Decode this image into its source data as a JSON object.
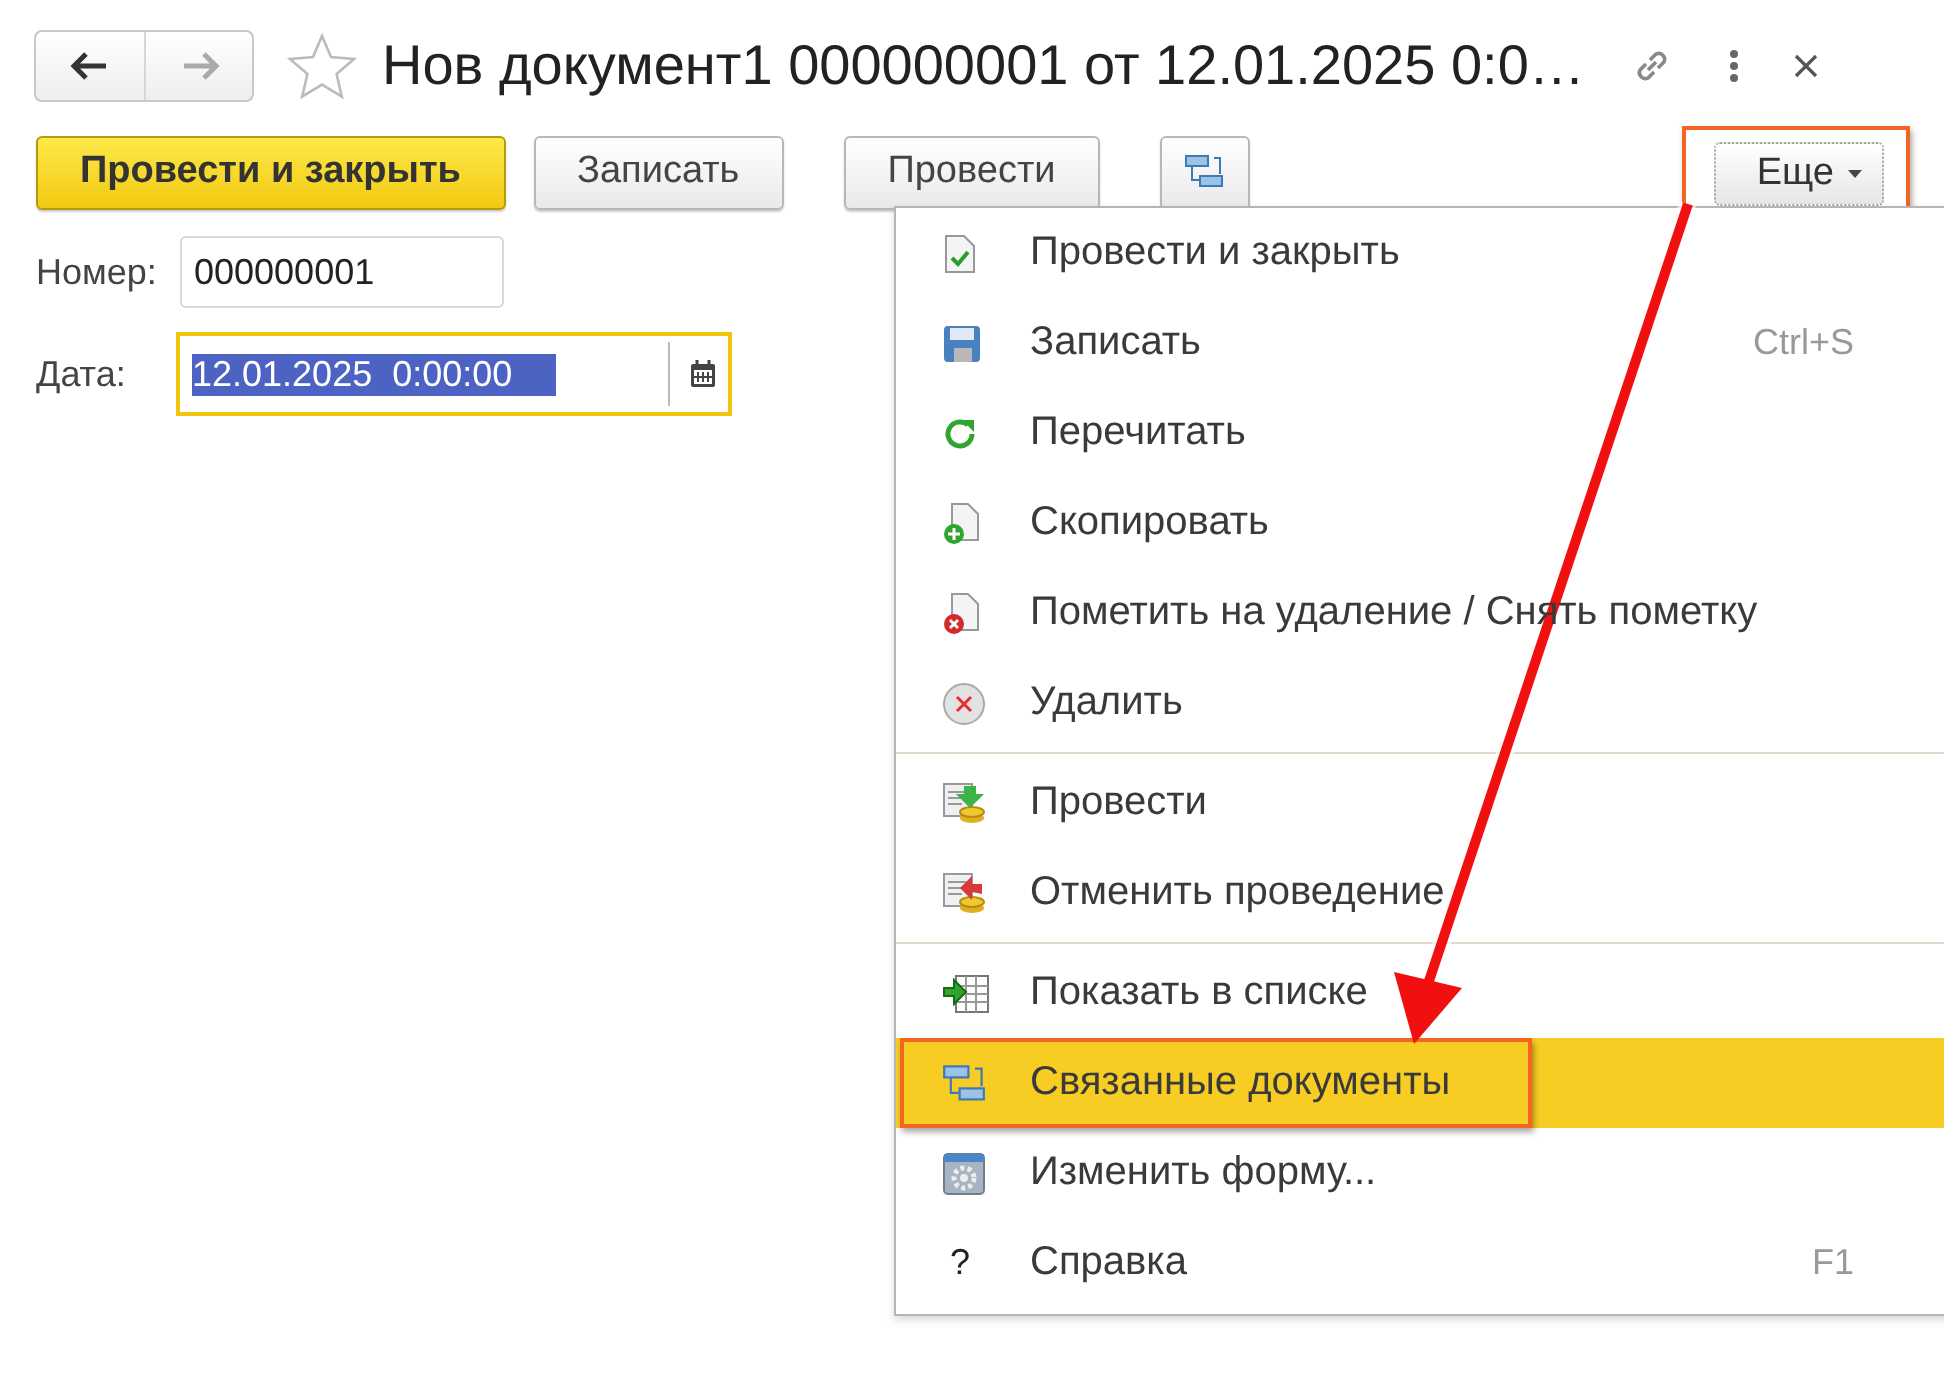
{
  "window": {
    "title": "Нов документ1 000000001 от 12.01.2025 0:0…",
    "favorite": false
  },
  "toolbar": {
    "buttons": [
      {
        "label": "Провести и закрыть",
        "kind": "default"
      },
      {
        "label": "Записать",
        "kind": "normal"
      },
      {
        "label": "Провести",
        "kind": "normal"
      },
      {
        "kind": "icon"
      }
    ],
    "more": {
      "label": "Еще",
      "highlighted": true
    }
  },
  "fields": [
    {
      "label": "Номер:",
      "value": "000000001",
      "focused": false
    },
    {
      "label": "Дата:",
      "value": "12.01.2025  0:00:00",
      "focused": true,
      "calendar": true
    }
  ],
  "menu": {
    "groups": [
      [
        {
          "label": "Провести и закрыть",
          "kind": "post-close",
          "selected": false
        },
        {
          "label": "Записать",
          "kind": "save",
          "shortcut": "Ctrl+S",
          "selected": false
        },
        {
          "label": "Перечитать",
          "kind": "reread",
          "selected": false
        },
        {
          "label": "Скопировать",
          "kind": "copy",
          "selected": false
        },
        {
          "label": "Пометить на удаление / Снять пометку",
          "kind": "mark",
          "selected": false
        },
        {
          "label": "Удалить",
          "kind": "delete",
          "selected": false
        }
      ],
      [
        {
          "label": "Провести",
          "kind": "post",
          "selected": false
        },
        {
          "label": "Отменить проведение",
          "kind": "unpost",
          "selected": false
        }
      ],
      [
        {
          "label": "Показать в списке",
          "kind": "show",
          "selected": false
        },
        {
          "label": "Связанные документы",
          "kind": "related",
          "selected": true,
          "highlighted": true
        },
        {
          "label": "Изменить форму...",
          "kind": "form",
          "selected": false
        },
        {
          "label": "Справка",
          "kind": "help",
          "glyph": "?",
          "shortcut": "F1",
          "selected": false
        }
      ]
    ]
  },
  "annotation": {
    "kind": "arrow"
  }
}
